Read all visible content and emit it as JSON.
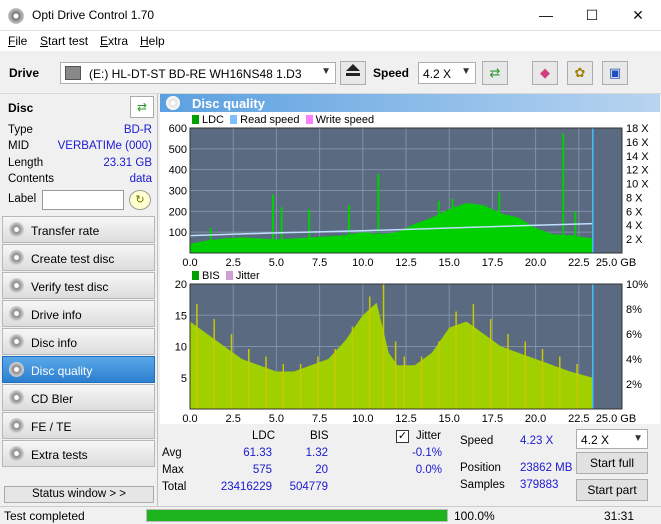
{
  "window": {
    "title": "Opti Drive Control 1.70",
    "minimize": "—",
    "maximize": "☐",
    "close": "✕"
  },
  "menu": [
    "File",
    "Start test",
    "Extra",
    "Help"
  ],
  "toolbar": {
    "drive_label": "Drive",
    "drive_value": "(E:)  HL-DT-ST BD-RE  WH16NS48 1.D3",
    "speed_label": "Speed",
    "speed_value": "4.2 X"
  },
  "disc": {
    "header": "Disc",
    "type_label": "Type",
    "type_value": "BD-R",
    "mid_label": "MID",
    "mid_value": "VERBATIMe (000)",
    "length_label": "Length",
    "length_value": "23.31 GB",
    "contents_label": "Contents",
    "contents_value": "data",
    "label_label": "Label",
    "label_value": ""
  },
  "nav": [
    {
      "label": "Transfer rate",
      "active": false
    },
    {
      "label": "Create test disc",
      "active": false
    },
    {
      "label": "Verify test disc",
      "active": false
    },
    {
      "label": "Drive info",
      "active": false
    },
    {
      "label": "Disc info",
      "active": false
    },
    {
      "label": "Disc quality",
      "active": true
    },
    {
      "label": "CD Bler",
      "active": false
    },
    {
      "label": "FE / TE",
      "active": false
    },
    {
      "label": "Extra tests",
      "active": false
    }
  ],
  "status_window_label": "Status window > >",
  "panel_title": "Disc quality",
  "chart_data": [
    {
      "type": "area",
      "legend": [
        "LDC",
        "Read speed",
        "Write speed"
      ],
      "colors": {
        "ldc": "#00d000",
        "read": "#40a0ff",
        "write": "#ff80ff"
      },
      "x_ticks": [
        "0.0",
        "2.5",
        "5.0",
        "7.5",
        "10.0",
        "12.5",
        "15.0",
        "17.5",
        "20.0",
        "22.5",
        "25.0 GB"
      ],
      "y_left_ticks": [
        "600",
        "500",
        "400",
        "300",
        "200",
        "100"
      ],
      "y_right_ticks": [
        "18 X",
        "16 X",
        "14 X",
        "12 X",
        "10 X",
        "8 X",
        "6 X",
        "4 X",
        "2 X"
      ],
      "xlim": [
        0,
        25
      ],
      "ylim": [
        0,
        600
      ],
      "ldc_x": [
        0,
        1,
        2,
        3,
        4,
        5,
        6,
        7,
        8,
        9,
        10,
        11,
        12,
        13,
        14,
        15,
        16,
        17,
        18,
        19,
        20,
        21,
        22,
        23.31
      ],
      "ldc_y": [
        45,
        60,
        70,
        75,
        70,
        65,
        70,
        75,
        80,
        85,
        100,
        90,
        100,
        140,
        170,
        210,
        240,
        230,
        190,
        170,
        120,
        90,
        85,
        70
      ],
      "ldc_spikes_x": [
        1.2,
        4.8,
        5.3,
        6.9,
        9.2,
        10.9,
        14.4,
        15.2,
        17.9,
        21.6,
        22.3
      ],
      "ldc_spikes_y": [
        120,
        280,
        220,
        210,
        230,
        380,
        250,
        260,
        290,
        575,
        200
      ],
      "read_speed_x": [
        0,
        5,
        10,
        15,
        20,
        23.31
      ],
      "read_speed_y": [
        2.5,
        2.9,
        3.2,
        3.6,
        4.0,
        4.23
      ]
    },
    {
      "type": "area",
      "legend": [
        "BIS",
        "Jitter"
      ],
      "colors": {
        "bis": "#a0d000",
        "jitter": "#ff80ff"
      },
      "x_ticks": [
        "0.0",
        "2.5",
        "5.0",
        "7.5",
        "10.0",
        "12.5",
        "15.0",
        "17.5",
        "20.0",
        "22.5",
        "25.0 GB"
      ],
      "y_left_ticks": [
        "20",
        "15",
        "10",
        "5"
      ],
      "y_right_ticks": [
        "10%",
        "8%",
        "6%",
        "4%",
        "2%"
      ],
      "xlim": [
        0,
        25
      ],
      "ylim": [
        0,
        20
      ],
      "bis_x": [
        0,
        1,
        2,
        3,
        4,
        5,
        6,
        7,
        8,
        9,
        10,
        10.8,
        11.5,
        12,
        13,
        14,
        15,
        16,
        17,
        18,
        19,
        20,
        21,
        22,
        23.31
      ],
      "bis_y": [
        14,
        12,
        10,
        8,
        7,
        6,
        6,
        7,
        8,
        11,
        15,
        17,
        9,
        7,
        7,
        9,
        13,
        14,
        12,
        10,
        9,
        8,
        7,
        6,
        5
      ]
    }
  ],
  "stats": {
    "col_ldc": "LDC",
    "col_bis": "BIS",
    "avg_label": "Avg",
    "avg_ldc": "61.33",
    "avg_bis": "1.32",
    "max_label": "Max",
    "max_ldc": "575",
    "max_bis": "20",
    "total_label": "Total",
    "total_ldc": "23416229",
    "total_bis": "504779",
    "jitter_label": "Jitter",
    "jitter_checked": "✓",
    "jitter_avg": "-0.1%",
    "jitter_max": "0.0%",
    "speed_label": "Speed",
    "speed_value": "4.23 X",
    "position_label": "Position",
    "position_value": "23862 MB",
    "samples_label": "Samples",
    "samples_value": "379883",
    "speed_select": "4.2 X",
    "start_full": "Start full",
    "start_part": "Start part"
  },
  "status": {
    "text": "Test completed",
    "progress": 100,
    "percent_label": "100.0%",
    "time": "31:31"
  }
}
